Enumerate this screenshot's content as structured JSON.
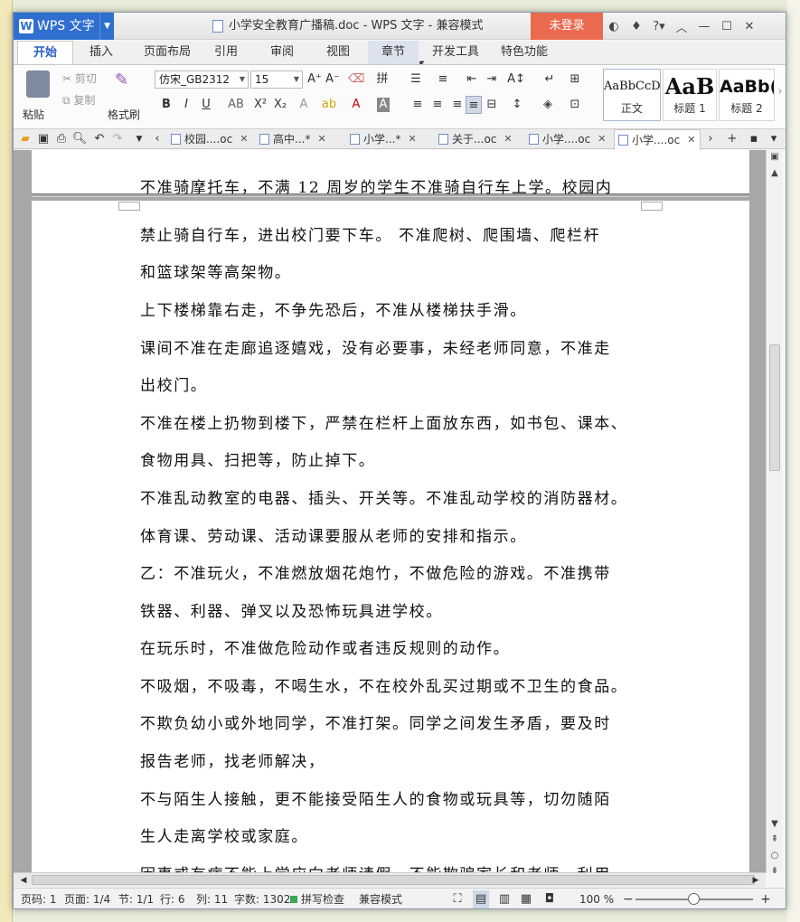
{
  "window": {
    "app_button": "WPS 文字",
    "title": "小学安全教育广播稿.doc - WPS 文字 - 兼容模式",
    "login": "未登录"
  },
  "tabs": [
    "开始",
    "插入",
    "页面布局",
    "引用",
    "审阅",
    "视图",
    "章节",
    "开发工具",
    "特色功能"
  ],
  "ribbon": {
    "paste": "粘贴",
    "cut": "剪切",
    "copy": "复制",
    "format_painter": "格式刷",
    "font_name": "仿宋_GB2312",
    "font_size": "15",
    "styles": [
      {
        "sample": "AaBbCcD",
        "label": "正文"
      },
      {
        "sample": "AaB",
        "label": "标题 1"
      },
      {
        "sample": "AaBb(",
        "label": "标题 2"
      }
    ]
  },
  "doc_tabs": [
    "校园....oc",
    "高中...*",
    "小学...*",
    "关于...oc",
    "小学....oc",
    "小学....oc"
  ],
  "document": {
    "lines": [
      "不准骑摩托车，不满 12 周岁的学生不准骑自行车上学。校园内",
      "禁止骑自行车，进出校门要下车。 不准爬树、爬围墙、爬栏杆",
      "和篮球架等高架物。",
      "上下楼梯靠右走，不争先恐后，不准从楼梯扶手滑。",
      "课间不准在走廊追逐嬉戏，没有必要事，未经老师同意，不准走",
      "出校门。",
      "不准在楼上扔物到楼下，严禁在栏杆上面放东西，如书包、课本、",
      "食物用具、扫把等，防止掉下。",
      "不准乱动教室的电器、插头、开关等。不准乱动学校的消防器材。",
      "体育课、劳动课、活动课要服从老师的安排和指示。",
      "乙：不准玩火，不准燃放烟花炮竹，不做危险的游戏。不准携带",
      "铁器、利器、弹叉以及恐怖玩具进学校。",
      "在玩乐时，不准做危险动作或者违反规则的动作。",
      "不吸烟，不吸毒，不喝生水，不在校外乱买过期或不卫生的食品。",
      "不欺负幼小或外地同学，不准打架。同学之间发生矛盾，要及时",
      "报告老师，找老师解决，",
      "不与陌生人接触，更不能接受陌生人的食物或玩具等，切勿随陌",
      "生人走离学校或家庭。",
      "因事或有病不能上学应向老师请假，不能欺骗家长和老师，利用"
    ]
  },
  "status": {
    "page_code": "页码: 1",
    "pages": "页面: 1/4",
    "section": "节: 1/1",
    "row": "行: 6",
    "col": "列: 11",
    "words": "字数: 1302",
    "spell": "拼写检查",
    "mode": "兼容模式",
    "zoom": "100 %"
  }
}
